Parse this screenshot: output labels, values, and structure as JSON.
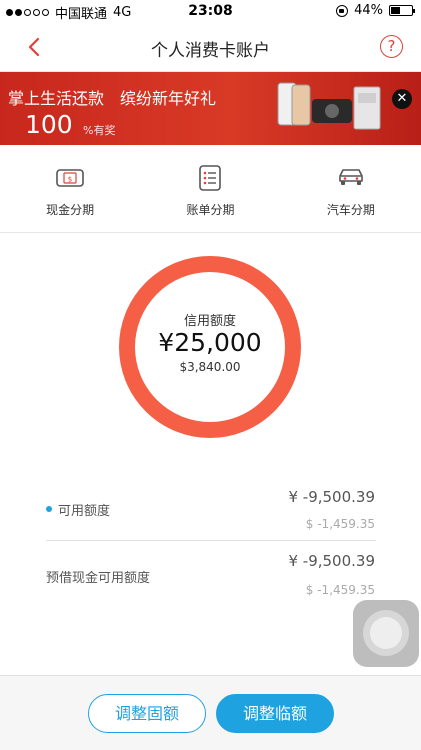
{
  "status_bar": {
    "carrier": "中国联通",
    "network": "4G",
    "time": "23:08",
    "battery": "44%",
    "battery_level": 0.44
  },
  "nav": {
    "title": "个人消费卡账户",
    "back_icon": "chevron-left-icon",
    "help_icon": "question-circle-icon",
    "help_glyph": "?"
  },
  "banner": {
    "line1": "掌上生活还款　缤纷新年好礼",
    "line2": "100",
    "line3": "%有奖",
    "close_glyph": "✕"
  },
  "menu": {
    "items": [
      {
        "label": "现金分期",
        "icon": "cash-card-icon"
      },
      {
        "label": "账单分期",
        "icon": "bill-list-icon"
      },
      {
        "label": "汽车分期",
        "icon": "car-icon"
      }
    ]
  },
  "credit": {
    "caption": "信用额度",
    "amount": "¥25,000",
    "usd_amount": "$3,840.00"
  },
  "available": {
    "label": "可用额度",
    "cny": "¥ -9,500.39",
    "usd": "$ -1,459.35"
  },
  "cash_available": {
    "label": "预借现金可用额度",
    "cny": "¥ -9,500.39",
    "usd": "$ -1,459.35"
  },
  "buttons": {
    "adjust_fixed": "调整固额",
    "adjust_temp": "调整临额"
  },
  "colors": {
    "accent_red": "#e1403a",
    "ring": "#f45f45",
    "primary_blue": "#1fa2e0"
  }
}
